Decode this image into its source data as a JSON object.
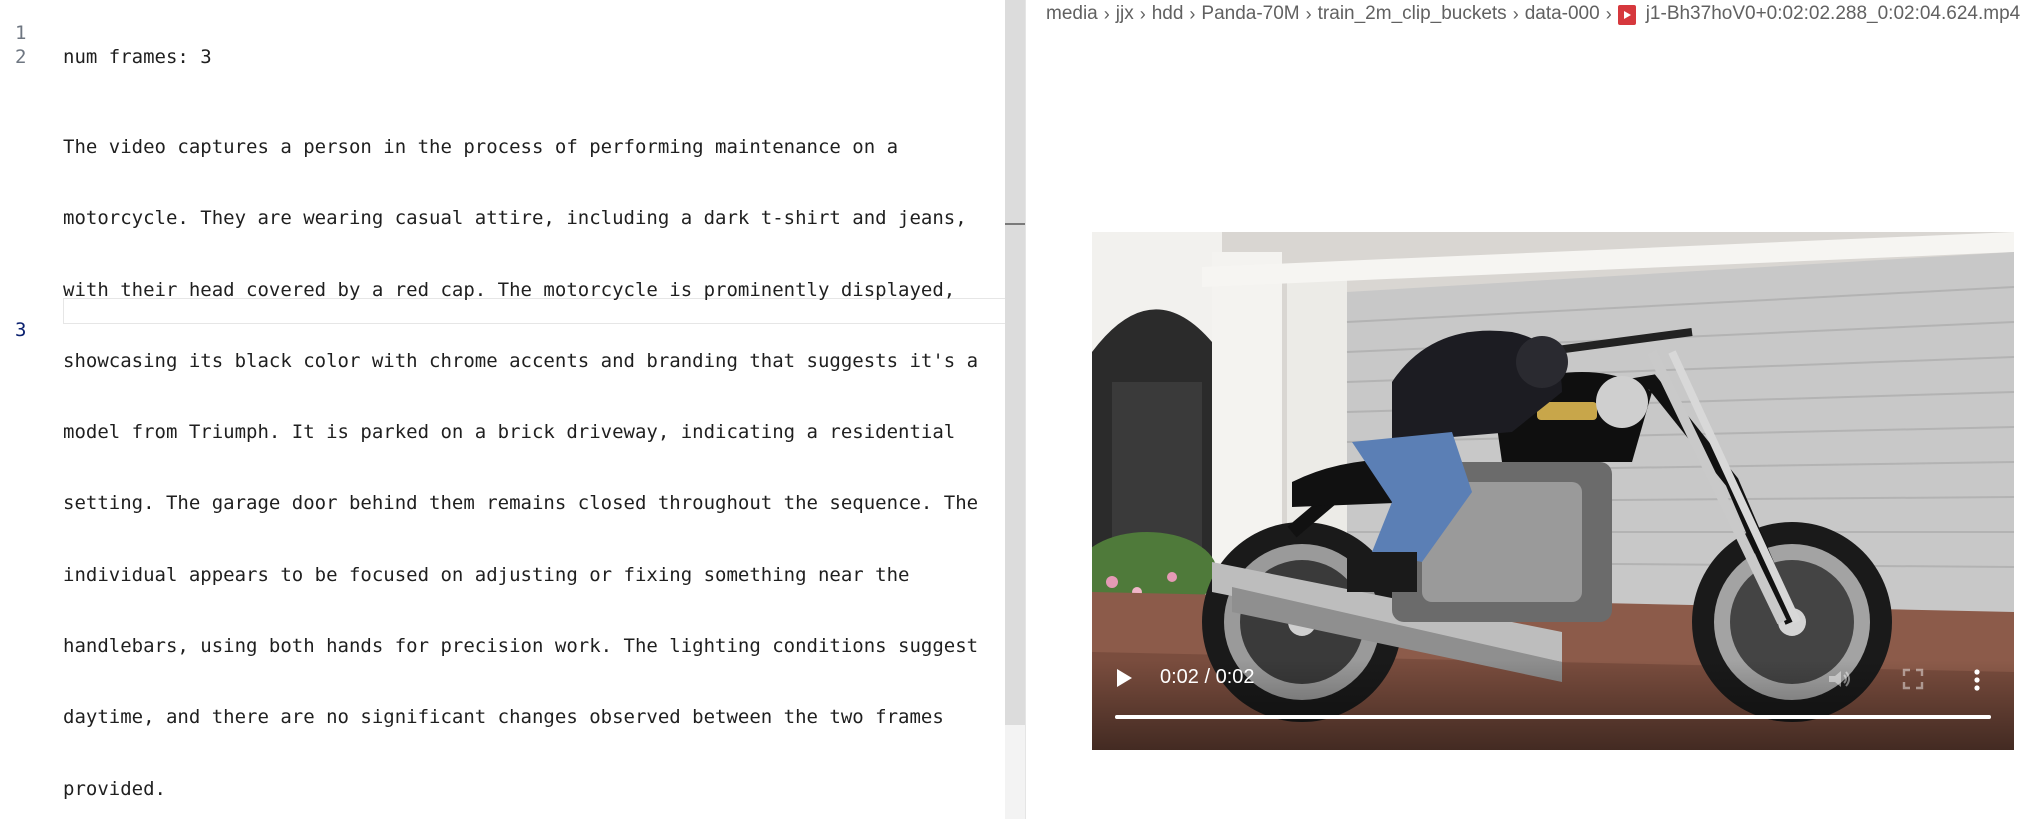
{
  "editor": {
    "lines": [
      {
        "number": "1",
        "rows": [
          "num frames: 3"
        ]
      },
      {
        "number": "2",
        "rows": [
          "The video captures a person in the process of performing maintenance on a",
          "motorcycle. They are wearing casual attire, including a dark t-shirt and jeans,",
          "with their head covered by a red cap. The motorcycle is prominently displayed,",
          "showcasing its black color with chrome accents and branding that suggests it's a",
          "model from Triumph. It is parked on a brick driveway, indicating a residential",
          "setting. The garage door behind them remains closed throughout the sequence. The",
          "individual appears to be focused on adjusting or fixing something near the",
          "handlebars, using both hands for precision work. The lighting conditions suggest",
          "daytime, and there are no significant changes observed between the two frames",
          "provided."
        ]
      },
      {
        "number": "3",
        "rows": [
          ""
        ]
      }
    ]
  },
  "breadcrumb": {
    "items": [
      "media",
      "jjx",
      "hdd",
      "Panda-70M",
      "train_2m_clip_buckets",
      "data-000"
    ],
    "file_name": "j1-Bh37hoV0+0:02:02.288_0:02:04.624.mp4",
    "file_icon": "video-file-icon"
  },
  "video": {
    "time_display": "0:02 / 0:02",
    "progress": 1.0,
    "icons": [
      "play-icon",
      "volume-icon",
      "fullscreen-icon",
      "more-options-icon"
    ]
  }
}
